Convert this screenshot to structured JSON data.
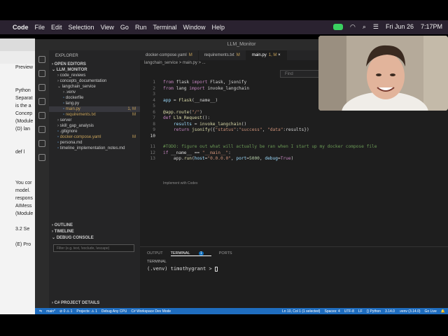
{
  "menubar": {
    "apple": "",
    "app": "Code",
    "items": [
      "File",
      "Edit",
      "Selection",
      "View",
      "Go",
      "Run",
      "Terminal",
      "Window",
      "Help"
    ],
    "date": "Fri Jun 26",
    "time": "7:17PM"
  },
  "browser": {
    "lines": [
      "Preview",
      "",
      "",
      "Python",
      "Separat",
      "is the a",
      "Concep",
      "(Module",
      "(D) lan",
      "",
      "",
      "def l",
      "",
      "",
      "",
      "You cor",
      "model.",
      "respons",
      "AIMess",
      "(Module",
      "",
      "3.2 Se",
      "",
      "(E) Pro"
    ]
  },
  "window_title": "LLM_Monitor",
  "sidebar": {
    "explorer": "EXPLORER",
    "open_editors": "OPEN EDITORS",
    "root": "LLM_MONITOR",
    "items": [
      {
        "label": "code_reviews",
        "indent": 1,
        "folder": true
      },
      {
        "label": "concepts_documentation",
        "indent": 1,
        "folder": true
      },
      {
        "label": "langchain_service",
        "indent": 1,
        "folder": true,
        "open": true
      },
      {
        "label": ".venv",
        "indent": 2,
        "folder": true
      },
      {
        "label": "dockerfile",
        "indent": 2
      },
      {
        "label": "lang.py",
        "indent": 2
      },
      {
        "label": "main.py",
        "indent": 2,
        "mark": "1, M",
        "selected": true
      },
      {
        "label": "requirements.txt",
        "indent": 2,
        "mark": "M"
      },
      {
        "label": "server",
        "indent": 1,
        "folder": true
      },
      {
        "label": "skill_gap_analysis",
        "indent": 1,
        "folder": true
      },
      {
        "label": ".gitignore",
        "indent": 1
      },
      {
        "label": "docker-compose.yaml",
        "indent": 1,
        "mark": "M"
      },
      {
        "label": "persona.md",
        "indent": 1
      },
      {
        "label": "timeline_implementation_notes.md",
        "indent": 1
      }
    ],
    "outline": "OUTLINE",
    "timeline": "TIMELINE",
    "debug_console": "DEBUG CONSOLE",
    "filter_placeholder": "Filter (e.g. text, !exclude, \\escape)",
    "csharp": "C# PROJECT DETAILS"
  },
  "tabs": [
    {
      "label": "docker-compose.yaml",
      "mark": "M"
    },
    {
      "label": "requirements.txt",
      "mark": "M"
    },
    {
      "label": "main.py",
      "mark": "1, M",
      "active": true
    }
  ],
  "breadcrumb": "langchain_service  >  main.py > ...",
  "find_placeholder": "Find",
  "code": [
    {
      "n": "1",
      "html": "<span class='kw'>from</span> flask <span class='kw'>import</span> Flask, jsonify"
    },
    {
      "n": "2",
      "html": "<span class='kw'>from</span> lang <span class='kw'>import</span> invoke_langchain"
    },
    {
      "n": "3",
      "html": ""
    },
    {
      "n": "4",
      "html": "<span class='va'>app</span> = <span class='fn'>Flask</span>(__name__)"
    },
    {
      "n": "5",
      "html": ""
    },
    {
      "n": "6",
      "html": "<span class='fn'>@app.route</span>(<span class='st'>\"/\"</span>)"
    },
    {
      "n": "7",
      "html": "<span class='kw'>def</span> <span class='fn'>Llm_Request</span>():"
    },
    {
      "n": "8",
      "html": "    <span class='va'>results</span> = <span class='fn'>invoke_langchain</span>()"
    },
    {
      "n": "9",
      "html": "    <span class='kw'>return</span> <span class='fn'>jsonify</span>({<span class='st'>\"status\"</span>:<span class='st'>\"success\"</span>, <span class='st'>\"data\"</span>:results})"
    },
    {
      "n": "10",
      "html": ""
    },
    {
      "n": "11",
      "html": "<span class='cm'>#TODO: figure out what will actually be ran when I start up my docker compose file</span>"
    },
    {
      "n": "12",
      "html": "<span class='kw'>if</span> __name__ == <span class='st'>\"__main__\"</span>:"
    },
    {
      "n": "13",
      "html": "    app.<span class='fn'>run</span>(<span class='va'>host</span>=<span class='st'>\"0.0.0.0\"</span>, <span class='va'>port</span>=<span class='nb'>5000</span>, <span class='va'>debug</span>=<span class='kw'>True</span>)"
    }
  ],
  "codelens": "Implement with Codex",
  "panel": {
    "tabs": [
      "OUTPUT",
      "TERMINAL",
      "PORTS"
    ],
    "terminal_badge": "1",
    "terminal_label": "TERMINAL",
    "prompt": "(.venv) timothygrant > "
  },
  "statusbar": {
    "left": [
      "main*",
      "⊘ 0 ⚠ 1",
      "Projects: ⚠ 1",
      "Debug Any CPU",
      "C# Workspace Dev Mode"
    ],
    "right": [
      "Ln 10, Col 1 (1 selected)",
      "Spaces: 4",
      "UTF-8",
      "LF",
      "{} Python",
      "3.14.0",
      ".venv (3.14.0)",
      "Go Live"
    ]
  }
}
